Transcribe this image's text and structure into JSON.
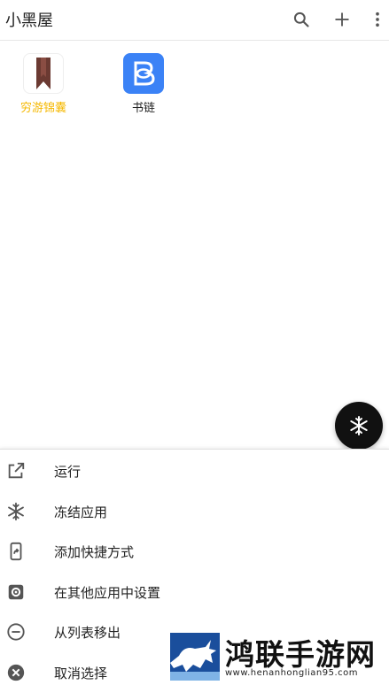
{
  "header": {
    "title": "小黑屋",
    "actions": [
      "search-icon",
      "add-icon",
      "more-vert-icon"
    ]
  },
  "apps": [
    {
      "label": "穷游锦囊",
      "label_color": "#f5b800",
      "icon": "bookmark-icon",
      "icon_color": "#6b3a32"
    },
    {
      "label": "书链",
      "label_color": "#222222",
      "icon": "book-chain-icon",
      "icon_color": "#3b82f6"
    }
  ],
  "fab": {
    "icon": "snowflake-icon"
  },
  "menu": [
    {
      "label": "运行",
      "icon": "open-external-icon"
    },
    {
      "label": "冻结应用",
      "icon": "snowflake-icon"
    },
    {
      "label": "添加快捷方式",
      "icon": "phone-shortcut-icon"
    },
    {
      "label": "在其他应用中设置",
      "icon": "gear-icon"
    },
    {
      "label": "从列表移出",
      "icon": "minus-circle-icon"
    },
    {
      "label": "取消选择",
      "icon": "close-circle-icon"
    }
  ],
  "watermark": {
    "name": "鸿联手游网",
    "url": "www.henanhonglian95.com",
    "color": "#1a4e9c"
  }
}
